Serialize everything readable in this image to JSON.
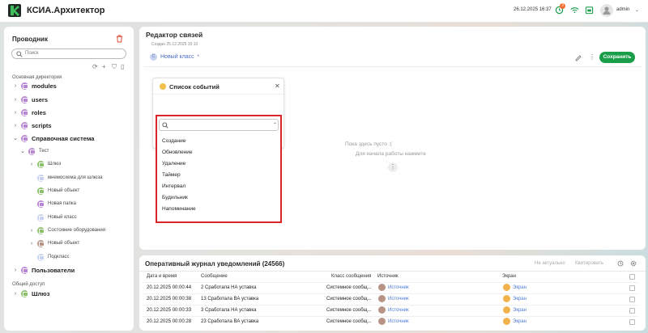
{
  "header": {
    "app_title": "КСИА.Архитектор",
    "datetime": "26.12.2025 16:37",
    "notification_count": "3",
    "user": "admin"
  },
  "explorer": {
    "title": "Проводник",
    "search_placeholder": "Поиск",
    "section_main": "Основная директория",
    "section_shared": "Общий доступ",
    "items": [
      {
        "label": "modules"
      },
      {
        "label": "users"
      },
      {
        "label": "roles"
      },
      {
        "label": "scripts"
      },
      {
        "label": "Справочная система"
      },
      {
        "label": "Тест"
      },
      {
        "label": "Шлюз"
      },
      {
        "label": "мнемосхема для шлюза"
      },
      {
        "label": "Новый объект"
      },
      {
        "label": "Новая папка"
      },
      {
        "label": "Новый класс"
      },
      {
        "label": "Состояние оборудования"
      },
      {
        "label": "Новый объект"
      },
      {
        "label": "Подкласс"
      },
      {
        "label": "Пользователи"
      },
      {
        "label": "Шлюз"
      }
    ]
  },
  "editor": {
    "title": "Редактор связей",
    "created": "Создан 25.12.2025 15:10",
    "class_tag": "Новый класс",
    "class_tag_letter": "С",
    "save_label": "Сохранить",
    "empty_line1": "Пока здесь пусто :(",
    "empty_line2": "Для начала работы нажмите",
    "events_panel_title": "Список событий",
    "event_options": [
      "Создание",
      "Обновление",
      "Удаление",
      "Таймер",
      "Интервал",
      "Будильник",
      "Напоминание"
    ]
  },
  "journal": {
    "title": "Оперативный журнал уведомлений (24566)",
    "btn_irrelevant": "Не актуально",
    "btn_quote": "Квитировать",
    "columns": [
      "Дата и время",
      "Сообщение",
      "Класс сообщения",
      "Источник",
      "Экран"
    ],
    "rows": [
      [
        "20.12.2025 00:00:44",
        "2 Сработала НА уставка",
        "Системное сообщ...",
        "Источник",
        "Экран"
      ],
      [
        "20.12.2025 00:00:38",
        "13 Сработала ВА уставка",
        "Системное сообщ...",
        "Источник",
        "Экран"
      ],
      [
        "20.12.2025 00:00:33",
        "3 Сработала НА уставка",
        "Системное сообщ...",
        "Источник",
        "Экран"
      ],
      [
        "20.12.2025 00:00:28",
        "23 Сработала ВА уставка",
        "Системное сообщ...",
        "Источник",
        "Экран"
      ]
    ]
  },
  "colors": {
    "accent_green": "#1b9e4a",
    "folder_purple": "#b985d6",
    "highlight_red": "#d9262c",
    "link_blue": "#4b7ad8",
    "badge_orange": "#f26a2a"
  }
}
